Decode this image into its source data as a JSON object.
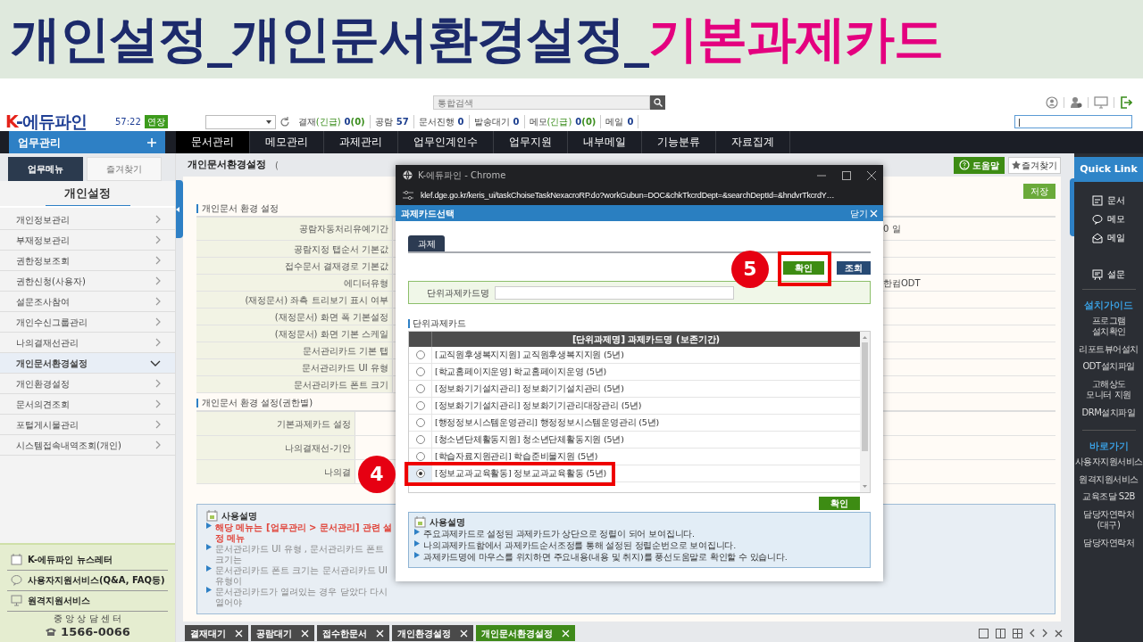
{
  "banner": {
    "title": "개인설정_개인문서환경설정_",
    "highlight": "기본과제카드"
  },
  "header": {
    "logo": "K-에듀파인",
    "timer": "57:22",
    "extend": "연장",
    "search": {
      "placeholder": "통합검색"
    },
    "counters": [
      {
        "label": "결재",
        "urgent": "(긴급)",
        "value": "0",
        "urgent_value": "(0)"
      },
      {
        "label": "공람",
        "value": "57"
      },
      {
        "label": "문서진행",
        "value": "0"
      },
      {
        "label": "발송대기",
        "value": "0"
      },
      {
        "label": "메모",
        "urgent": "(긴급)",
        "value": "0",
        "urgent_value": "(0)"
      },
      {
        "label": "메일",
        "value": "0"
      }
    ],
    "user_field": {
      "value": "|"
    }
  },
  "nav": {
    "menu_button": "업무관리",
    "items": [
      {
        "label": "문서관리",
        "selected": true
      },
      {
        "label": "메모관리",
        "selected": false
      },
      {
        "label": "과제관리",
        "selected": false
      },
      {
        "label": "업무인계인수",
        "selected": false
      },
      {
        "label": "업무지원",
        "selected": false
      },
      {
        "label": "내부메일",
        "selected": false
      },
      {
        "label": "기능분류",
        "selected": false
      },
      {
        "label": "자료집계",
        "selected": false
      }
    ]
  },
  "sidebar": {
    "tabs": [
      {
        "label": "업무메뉴",
        "selected": true
      },
      {
        "label": "즐겨찾기",
        "selected": false
      }
    ],
    "heading": "개인설정",
    "items": [
      {
        "label": "개인정보관리",
        "selected": false
      },
      {
        "label": "부재정보관리",
        "selected": false
      },
      {
        "label": "권한정보조회",
        "selected": false
      },
      {
        "label": "권한신청(사용자)",
        "selected": false
      },
      {
        "label": "설문조사참여",
        "selected": false
      },
      {
        "label": "개인수신그룹관리",
        "selected": false
      },
      {
        "label": "나의결재선관리",
        "selected": false
      },
      {
        "label": "개인문서환경설정",
        "selected": true
      },
      {
        "label": "개인환경설정",
        "selected": false
      },
      {
        "label": "문서의견조회",
        "selected": false
      },
      {
        "label": "포털게시물관리",
        "selected": false
      },
      {
        "label": "시스템접속내역조회(개인)",
        "selected": false
      }
    ],
    "links": [
      {
        "label": "K-에듀파인 뉴스레터",
        "kind": "newsletter"
      },
      {
        "label": "사용자지원서비스(Q&A, FAQ등)",
        "kind": "chat"
      },
      {
        "label": "원격지원서비스",
        "kind": "monitor"
      }
    ],
    "center": "중 앙 상 담 센 터",
    "phone": "1566-0066"
  },
  "content": {
    "title": "개인문서환경설정",
    "title_suffix": "(",
    "help": "도움말",
    "favorite": "즐겨찾기",
    "save": "저장",
    "sections": [
      {
        "title": "개인문서 환경 설정",
        "rows": [
          {
            "label": "공람자동처리유예기간",
            "value": "0 일"
          },
          {
            "label": "공람지정 탭순서 기본값"
          },
          {
            "label": "접수문서 결재경로 기본값"
          },
          {
            "label": "에디터유형",
            "value": "한컴ODT"
          },
          {
            "label": "(재정문서) 좌측 트리보기 표시 여부"
          },
          {
            "label": "(재정문서) 화면 폭 기본설정"
          },
          {
            "label": "(재정문서) 화면 기본 스케일"
          },
          {
            "label": "문서관리카드 기본 탭"
          },
          {
            "label": "문서관리카드 UI 유형"
          },
          {
            "label": "문서관리카드 폰트 크기"
          }
        ]
      },
      {
        "title": "개인문서 환경 설정(권한별)",
        "rows": [
          {
            "label": "기본과제카드 설정"
          },
          {
            "label": "나의결재선-기안"
          },
          {
            "label": "나의결"
          }
        ]
      }
    ],
    "usage": {
      "title": "사용설명",
      "lines": [
        {
          "text": "해당 메뉴는 [업무관리 > 문서관리] 관련 설정 메뉴",
          "emphasis": true
        },
        {
          "text": "문서관리카드 UI 유형 , 문서관리카드 폰트 크기는",
          "emphasis": false
        },
        {
          "text": "문서관리카드 폰트 크기는 문서관리카드 UI 유형이",
          "emphasis": false
        },
        {
          "text": "문서관리카드가 열려있는 경우 닫았다 다시 열어야",
          "emphasis": false
        }
      ]
    },
    "bottom_tabs": [
      {
        "label": "결재대기",
        "selected": false
      },
      {
        "label": "공람대기",
        "selected": false
      },
      {
        "label": "접수한문서",
        "selected": false
      },
      {
        "label": "개인환경설정",
        "selected": false
      },
      {
        "label": "개인문서환경설정",
        "selected": true
      }
    ]
  },
  "quick_link": {
    "title": "Quick Link",
    "shortcuts": [
      {
        "label": "문서",
        "kind": "document"
      },
      {
        "label": "메모",
        "kind": "memo"
      },
      {
        "label": "메일",
        "kind": "mail"
      },
      {
        "label": "설문",
        "kind": "survey"
      }
    ],
    "groups": [
      {
        "title": "설치가이드",
        "items": [
          "프로그램\n설치확인",
          "리포트뷰어설치",
          "ODT설치파일",
          "고해상도\n모니터 지원",
          "DRM설치파일"
        ]
      },
      {
        "title": "바로가기",
        "items": [
          "사용자지원서비스",
          "원격지원서비스",
          "교육조달 S2B",
          "담당자연락처\n(대구)",
          "담당자연락처"
        ]
      }
    ]
  },
  "dialog": {
    "window_title": "K-에듀파인 - Chrome",
    "url": "klef.dge.go.kr/keris_ui/taskChoiseTaskNexacroRP.do?workGubun=DOC&chkTkcrdDept=&searchDeptId=&hndvrTkcrdY…",
    "title": "과제카드선택",
    "close": "닫기",
    "tabs": [
      {
        "label": "과제",
        "selected": true
      }
    ],
    "confirm": "확인",
    "search": "조회",
    "field_label": "단위과제카드명",
    "section": "단위과제카드",
    "column": "[단위과제명] 과제카드명 (보존기간)",
    "rows": [
      {
        "text": "[교직원후생복지지원] 교직원후생복지지원 (5년)",
        "selected": false
      },
      {
        "text": "[학교홈페이지운영] 학교홈페이지운영 (5년)",
        "selected": false
      },
      {
        "text": "[정보화기기설치관리] 정보화기기설치관리 (5년)",
        "selected": false
      },
      {
        "text": "[정보화기기설치관리] 정보화기기관리대장관리 (5년)",
        "selected": false
      },
      {
        "text": "[행정정보시스템운영관리] 행정정보시스템운영관리 (5년)",
        "selected": false
      },
      {
        "text": "[청소년단체활동지원] 청소년단체활동지원 (5년)",
        "selected": false
      },
      {
        "text": "[학습자료지원관리] 학습준비물지원 (5년)",
        "selected": false
      },
      {
        "text": "[정보교과교육활동] 정보교과교육활동 (5년)",
        "selected": true
      }
    ],
    "confirm_bottom": "확인",
    "usage": {
      "title": "사용설명",
      "lines": [
        "주요과제카드로 설정된 과제카드가 상단으로 정렬이 되어 보여집니다.",
        "나의과제카드함에서 과제카드순서조정를 통해 설정된 정렬순번으로 보여집니다.",
        "과제카드명에 마우스를 위치하면 주요내용(내용 및 취지)를 풍선도움말로 확인할 수 있습니다."
      ]
    }
  },
  "annotations": [
    {
      "number": "5"
    },
    {
      "number": "4"
    }
  ]
}
